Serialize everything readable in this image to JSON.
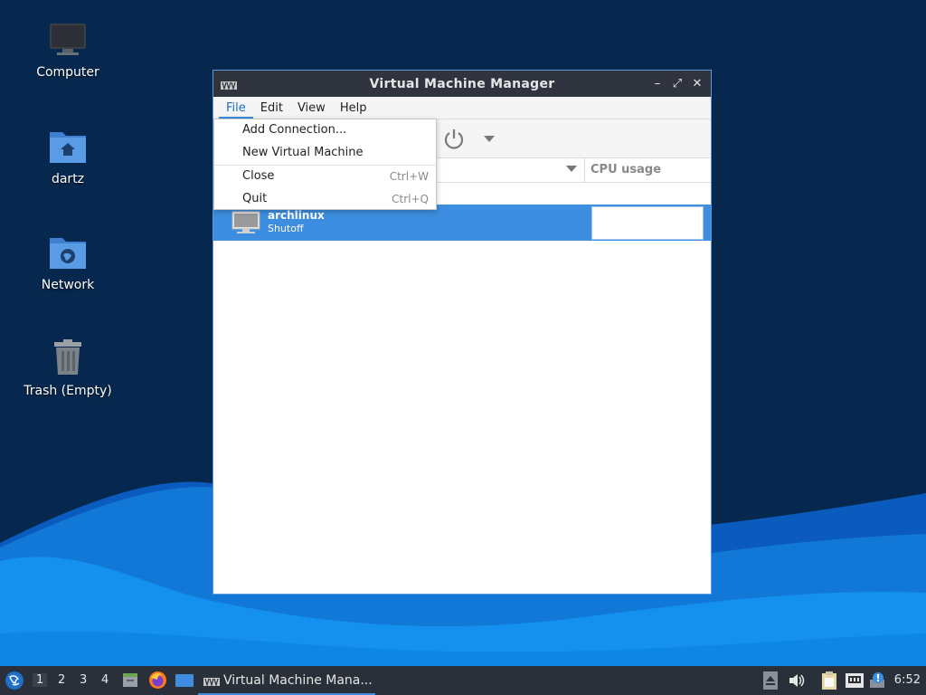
{
  "desktop": {
    "icons": [
      {
        "label": "Computer",
        "icon": "monitor-icon"
      },
      {
        "label": "dartz",
        "icon": "home-folder-icon"
      },
      {
        "label": "Network",
        "icon": "network-folder-icon"
      },
      {
        "label": "Trash (Empty)",
        "icon": "trash-icon"
      }
    ]
  },
  "window": {
    "title": "Virtual Machine Manager",
    "controls": {
      "minimize": "–",
      "maximize": "⤢",
      "close": "✕"
    },
    "menubar": [
      "File",
      "Edit",
      "View",
      "Help"
    ],
    "active_menu": "File",
    "columns": {
      "cpu_usage": "CPU usage"
    },
    "vm": {
      "name": "archlinux",
      "state": "Shutoff"
    }
  },
  "file_menu": {
    "items": [
      {
        "label": "Add Connection...",
        "accel": ""
      },
      {
        "label": "New Virtual Machine",
        "accel": ""
      },
      {
        "label": "Close",
        "accel": "Ctrl+W"
      },
      {
        "label": "Quit",
        "accel": "Ctrl+Q"
      }
    ]
  },
  "taskbar": {
    "workspaces": [
      "1",
      "2",
      "3",
      "4"
    ],
    "active_workspace": "1",
    "task_title": "Virtual Machine Mana...",
    "clock": "6:52"
  },
  "colors": {
    "accent": "#3d8ee0",
    "titlebar": "#2f343f",
    "taskbar": "#2a3039",
    "desktop": "#06284f"
  }
}
